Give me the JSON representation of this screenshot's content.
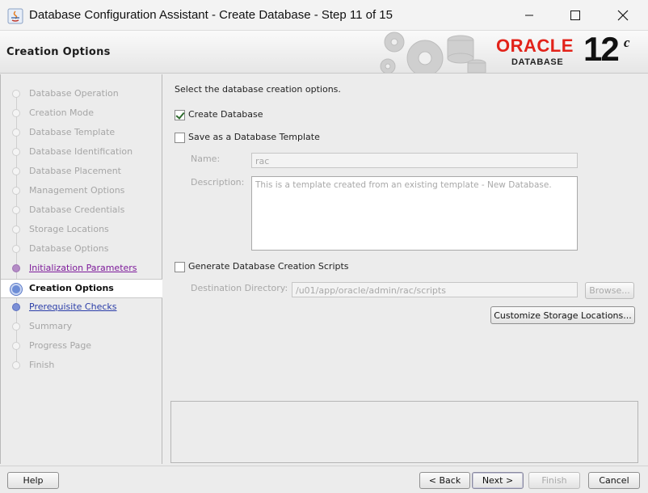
{
  "window": {
    "title": "Database Configuration Assistant - Create Database - Step 11 of 15"
  },
  "header": {
    "page_title": "Creation Options",
    "brand": {
      "oracle": "ORACLE",
      "database": "DATABASE",
      "version": "12",
      "version_suffix": "c"
    }
  },
  "nav": {
    "steps": [
      {
        "label": "Database Operation",
        "state": "disabled"
      },
      {
        "label": "Creation Mode",
        "state": "disabled"
      },
      {
        "label": "Database Template",
        "state": "disabled"
      },
      {
        "label": "Database Identification",
        "state": "disabled"
      },
      {
        "label": "Database Placement",
        "state": "disabled"
      },
      {
        "label": "Management Options",
        "state": "disabled"
      },
      {
        "label": "Database Credentials",
        "state": "disabled"
      },
      {
        "label": "Storage Locations",
        "state": "disabled"
      },
      {
        "label": "Database Options",
        "state": "disabled"
      },
      {
        "label": "Initialization Parameters",
        "state": "visited"
      },
      {
        "label": "Creation Options",
        "state": "active"
      },
      {
        "label": "Prerequisite Checks",
        "state": "link"
      },
      {
        "label": "Summary",
        "state": "disabled"
      },
      {
        "label": "Progress Page",
        "state": "disabled"
      },
      {
        "label": "Finish",
        "state": "disabled"
      }
    ]
  },
  "main": {
    "prompt": "Select the database creation options.",
    "create_database": {
      "label": "Create Database",
      "checked": true
    },
    "save_template": {
      "label": "Save as a Database Template",
      "checked": false
    },
    "name": {
      "label": "Name:",
      "value": "rac"
    },
    "description": {
      "label": "Description:",
      "value": "This is a template created from an existing template - New Database."
    },
    "generate_scripts": {
      "label": "Generate Database Creation Scripts",
      "checked": false
    },
    "destination": {
      "label": "Destination Directory:",
      "value": "/u01/app/oracle/admin/rac/scripts",
      "browse_label": "Browse..."
    },
    "customize_label": "Customize Storage Locations..."
  },
  "footer": {
    "help": "Help",
    "back": "< Back",
    "next": "Next >",
    "finish": "Finish",
    "cancel": "Cancel"
  },
  "colors": {
    "oracle_red": "#e2231a",
    "visited_link": "#7d1a9a",
    "link": "#2a3da8",
    "active_step_bg": "#ffffff"
  }
}
